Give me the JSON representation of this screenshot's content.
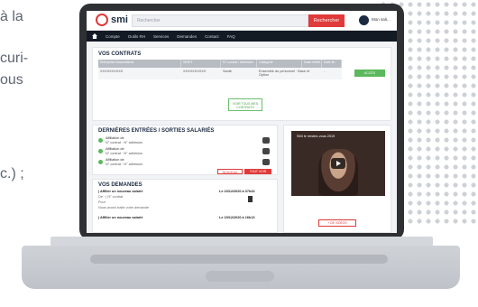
{
  "background_text": {
    "line1": "à la",
    "line2": "curi-",
    "line3": "ous",
    "line4": "c.) ;"
  },
  "header": {
    "logo": "smi",
    "search_placeholder": "Rechercher",
    "search_button": "Rechercher",
    "user_name": "Mon salr..."
  },
  "navbar": {
    "items": [
      "Compte",
      "Outils RH",
      "Services",
      "Demandes",
      "Contact",
      "FAQ"
    ]
  },
  "contracts": {
    "title": "VOS CONTRATS",
    "headers": [
      "Entreprise Associations",
      "SIRET",
      "N° contrat / Adhésion",
      "Catégorie",
      "Date d'effet",
      "Date fin"
    ],
    "row": [
      "XXXXXXXXXX",
      "XXXXXXXXXX",
      "Santé",
      "Ensemble du personnel · Base et Option",
      "-"
    ],
    "action_button": "ACCÈS",
    "view_button": "VOIR TOUS MES CONTRATS"
  },
  "movements": {
    "title": "DERNIÈRES ENTRÉES / SORTIES SALARIÉS",
    "items": [
      {
        "line1": "Affiliation de",
        "line2": "N° contrat · N° adhésion"
      },
      {
        "line1": "Affiliation de",
        "line2": "N° contrat · N° adhésion"
      },
      {
        "line1": "Affiliation de",
        "line2": "N° contrat · N° adhésion"
      }
    ],
    "btn_new": "NOUVEAU",
    "btn_all": "TOUT VOIR"
  },
  "requests": {
    "title": "VOS DEMANDES",
    "items": [
      {
        "title": "| Affilier un nouveau salarié",
        "date": "Le 23/12/2020 à 07h43",
        "line2": "De · | N° contrat",
        "line3": "Pour",
        "line4": "Nous avons traité votre demande"
      },
      {
        "title": "| Affilier un nouveau salarié",
        "date": "Le 15/12/2020 à 16h13"
      }
    ]
  },
  "video": {
    "title": "SMI le rendez-vous 2019",
    "more_button": "+ DE VIDÉOS"
  }
}
